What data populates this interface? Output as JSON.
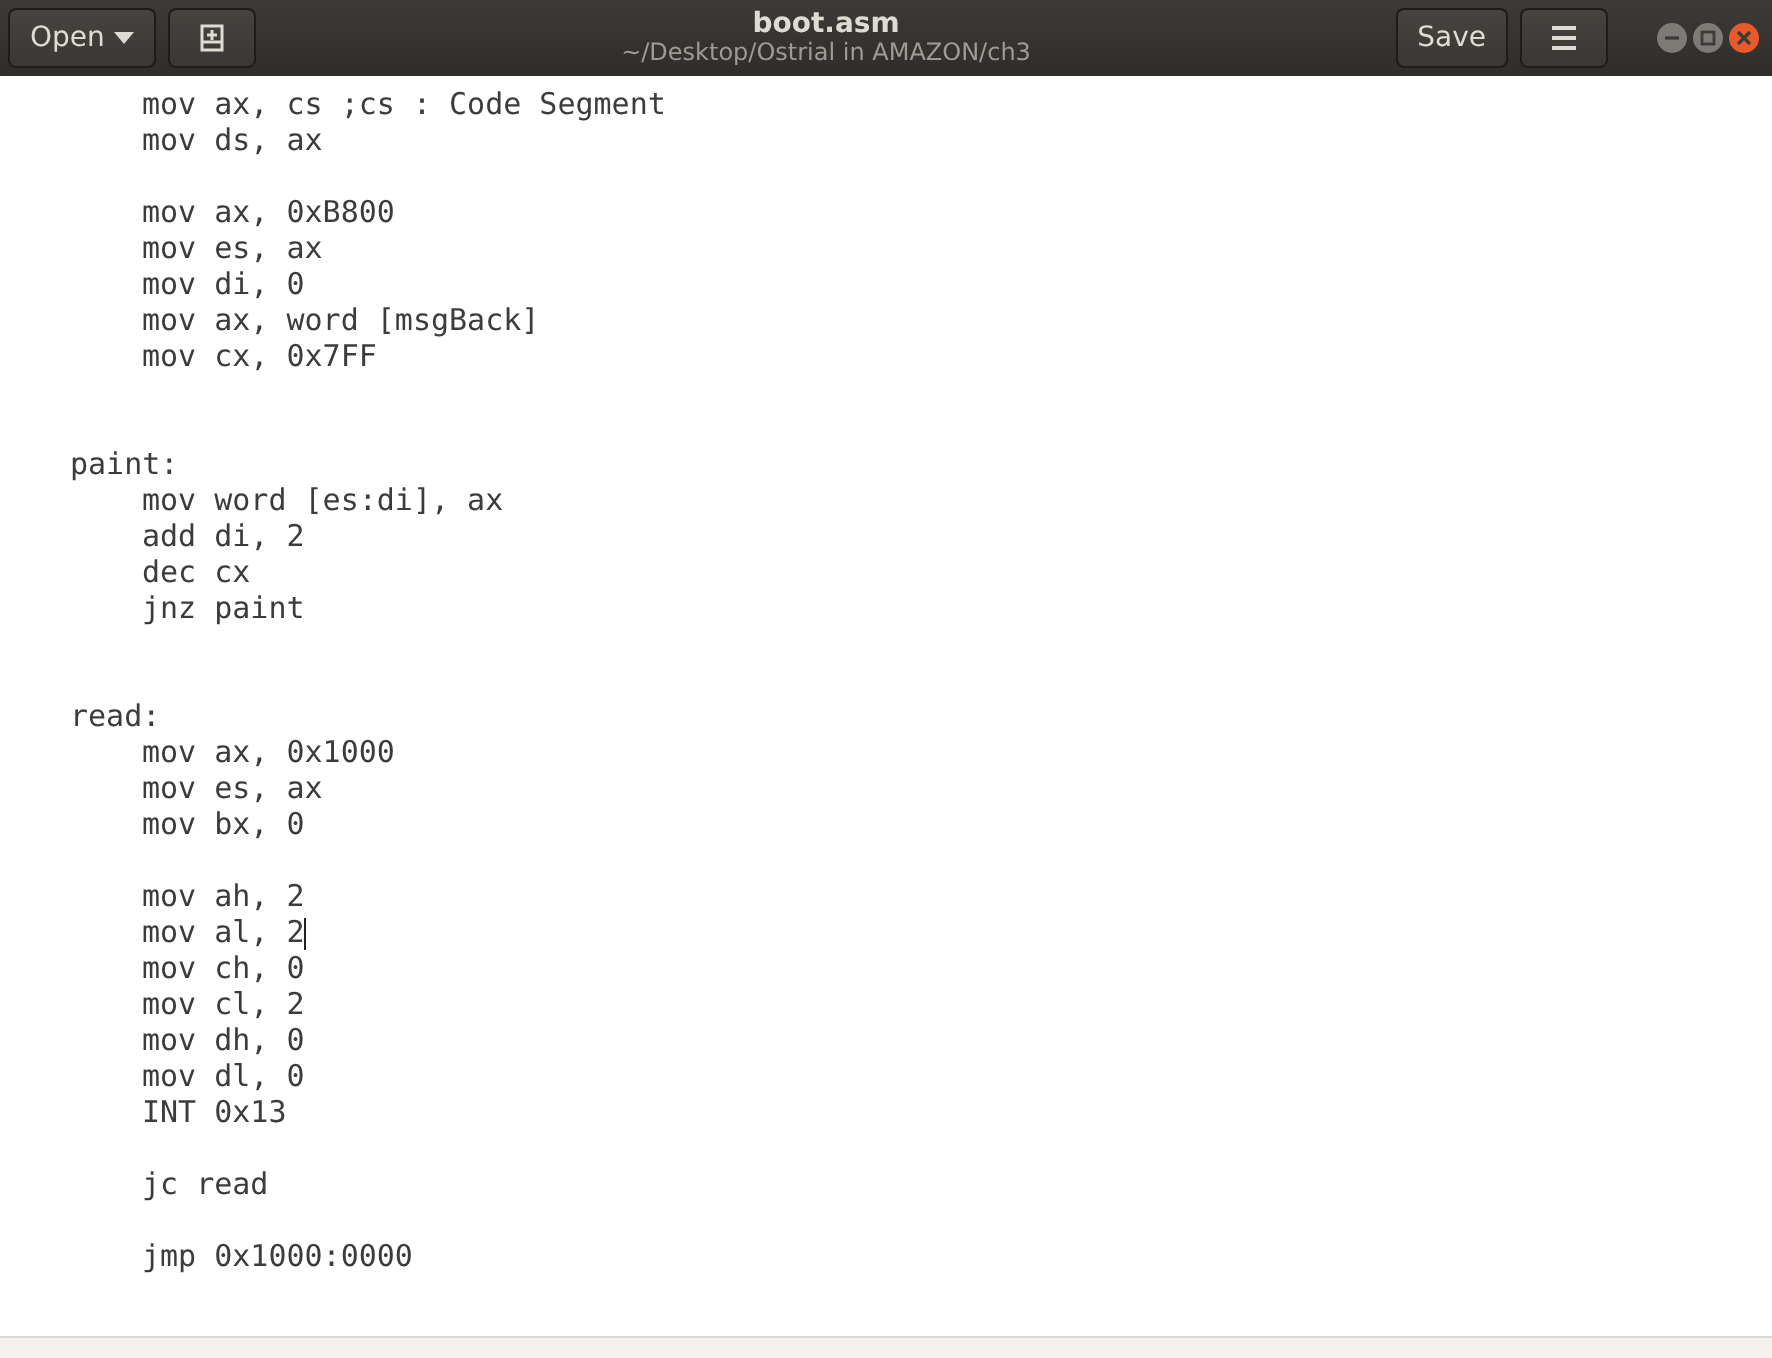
{
  "header": {
    "open_button": "Open",
    "title": "boot.asm",
    "subtitle": "~/Desktop/Ostrial in AMAZON/ch3",
    "save_button": "Save"
  },
  "lines": [
    {
      "kind": "instruction",
      "text": "mov ax, cs ;cs : Code Segment",
      "cursor": false
    },
    {
      "kind": "instruction",
      "text": "mov ds, ax",
      "cursor": false
    },
    {
      "kind": "blank"
    },
    {
      "kind": "instruction",
      "text": "mov ax, 0xB800",
      "cursor": false
    },
    {
      "kind": "instruction",
      "text": "mov es, ax",
      "cursor": false
    },
    {
      "kind": "instruction",
      "text": "mov di, 0",
      "cursor": false
    },
    {
      "kind": "instruction",
      "text": "mov ax, word [msgBack]",
      "cursor": false
    },
    {
      "kind": "instruction",
      "text": "mov cx, 0x7FF",
      "cursor": false
    },
    {
      "kind": "blank"
    },
    {
      "kind": "blank"
    },
    {
      "kind": "label",
      "text": "paint:",
      "cursor": false
    },
    {
      "kind": "instruction",
      "text": "mov word [es:di], ax",
      "cursor": false
    },
    {
      "kind": "instruction",
      "text": "add di, 2",
      "cursor": false
    },
    {
      "kind": "instruction",
      "text": "dec cx",
      "cursor": false
    },
    {
      "kind": "instruction",
      "text": "jnz paint",
      "cursor": false
    },
    {
      "kind": "blank"
    },
    {
      "kind": "blank"
    },
    {
      "kind": "label",
      "text": "read:",
      "cursor": false
    },
    {
      "kind": "instruction",
      "text": "mov ax, 0x1000",
      "cursor": false
    },
    {
      "kind": "instruction",
      "text": "mov es, ax",
      "cursor": false
    },
    {
      "kind": "instruction",
      "text": "mov bx, 0",
      "cursor": false
    },
    {
      "kind": "blank"
    },
    {
      "kind": "instruction",
      "text": "mov ah, 2",
      "cursor": false
    },
    {
      "kind": "instruction",
      "text": "mov al, 2",
      "cursor": true
    },
    {
      "kind": "instruction",
      "text": "mov ch, 0",
      "cursor": false
    },
    {
      "kind": "instruction",
      "text": "mov cl, 2",
      "cursor": false
    },
    {
      "kind": "instruction",
      "text": "mov dh, 0",
      "cursor": false
    },
    {
      "kind": "instruction",
      "text": "mov dl, 0",
      "cursor": false
    },
    {
      "kind": "instruction",
      "text": "INT 0x13",
      "cursor": false
    },
    {
      "kind": "blank"
    },
    {
      "kind": "instruction",
      "text": "jc read",
      "cursor": false
    },
    {
      "kind": "blank"
    },
    {
      "kind": "instruction",
      "text": "jmp 0x1000:0000",
      "cursor": false
    }
  ]
}
